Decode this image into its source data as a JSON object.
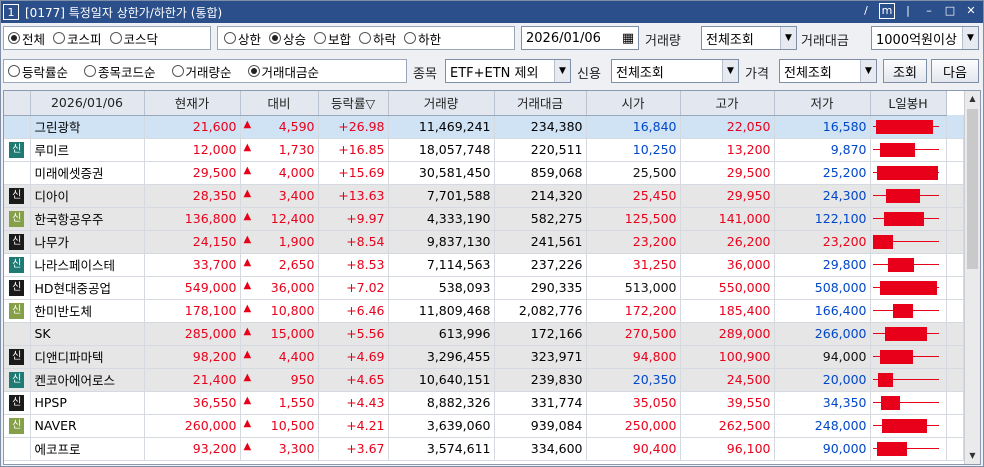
{
  "window": {
    "number": "1",
    "title": "[0177] 특정일자 상한가/하한가 (통합)"
  },
  "title_controls": [
    "/",
    "m",
    "|",
    "–",
    "□",
    "✕"
  ],
  "market": {
    "options": [
      "전체",
      "코스피",
      "코스닥"
    ],
    "selected": 0
  },
  "limit": {
    "options": [
      "상한",
      "상승",
      "보합",
      "하락",
      "하한"
    ],
    "selected": 1
  },
  "date_value": "2026/01/06",
  "volume": {
    "label": "거래량",
    "value": "전체조회"
  },
  "amount": {
    "label": "거래대금",
    "value": "1000억원이상"
  },
  "sort": {
    "options": [
      "등락률순",
      "종목코드순",
      "거래량순",
      "거래대금순"
    ],
    "selected": 3
  },
  "stock_filter": {
    "label": "종목",
    "value": "ETF+ETN 제외"
  },
  "credit": {
    "label": "신용",
    "value": "전체조회"
  },
  "price": {
    "label": "가격",
    "value": "전체조회"
  },
  "buttons": {
    "search": "조회",
    "next": "다음"
  },
  "columns": [
    "2026/01/06",
    "현재가",
    "대비",
    "등락률▽",
    "거래량",
    "거래대금",
    "시가",
    "고가",
    "저가",
    "L일봉H"
  ],
  "rows": [
    {
      "badge": "",
      "name": "그린광학",
      "price": "21,600",
      "diff": "4,590",
      "rate": "+26.98",
      "volume": "11,469,241",
      "amount": "234,380",
      "open": "16,840",
      "high": "22,050",
      "low": "16,580",
      "open_color": "blue",
      "low_color": "blue",
      "bg": "sel",
      "mark": false,
      "candle": {
        "open": 16840,
        "high": 22050,
        "low": 16580,
        "close": 21600
      }
    },
    {
      "badge": "신",
      "name": "루미르",
      "price": "12,000",
      "diff": "1,730",
      "rate": "+16.85",
      "volume": "18,057,748",
      "amount": "220,511",
      "open": "10,250",
      "high": "13,200",
      "low": "9,870",
      "open_color": "blue",
      "low_color": "blue",
      "bg": "",
      "mark": false,
      "candle": {
        "open": 10250,
        "high": 13200,
        "low": 9870,
        "close": 12000
      }
    },
    {
      "badge": "",
      "name": "미래에셋증권",
      "price": "29,500",
      "diff": "4,000",
      "rate": "+15.69",
      "volume": "30,581,450",
      "amount": "859,068",
      "open": "25,500",
      "high": "29,500",
      "low": "25,200",
      "open_color": "blk",
      "low_color": "blue",
      "bg": "",
      "mark": true,
      "candle": {
        "open": 25500,
        "high": 29500,
        "low": 25200,
        "close": 29500
      }
    },
    {
      "badge": "신",
      "name": "디아이",
      "price": "28,350",
      "diff": "3,400",
      "rate": "+13.63",
      "volume": "7,701,588",
      "amount": "214,320",
      "open": "25,450",
      "high": "29,950",
      "low": "24,300",
      "open_color": "red",
      "low_color": "blue",
      "bg": "gray",
      "mark": false,
      "candle": {
        "open": 25450,
        "high": 29950,
        "low": 24300,
        "close": 28350
      }
    },
    {
      "badge": "신",
      "name": "한국항공우주",
      "price": "136,800",
      "diff": "12,400",
      "rate": "+9.97",
      "volume": "4,333,190",
      "amount": "582,275",
      "open": "125,500",
      "high": "141,000",
      "low": "122,100",
      "open_color": "red",
      "low_color": "blue",
      "bg": "gray",
      "mark": true,
      "candle": {
        "open": 125500,
        "high": 141000,
        "low": 122100,
        "close": 136800
      }
    },
    {
      "badge": "신",
      "name": "나무가",
      "price": "24,150",
      "diff": "1,900",
      "rate": "+8.54",
      "volume": "9,837,130",
      "amount": "241,561",
      "open": "23,200",
      "high": "26,200",
      "low": "23,200",
      "open_color": "red",
      "low_color": "red",
      "bg": "gray",
      "mark": false,
      "candle": {
        "open": 23200,
        "high": 26200,
        "low": 23200,
        "close": 24150
      }
    },
    {
      "badge": "신",
      "name": "나라스페이스테",
      "price": "33,700",
      "diff": "2,650",
      "rate": "+8.53",
      "volume": "7,114,563",
      "amount": "237,226",
      "open": "31,250",
      "high": "36,000",
      "low": "29,800",
      "open_color": "red",
      "low_color": "blue",
      "bg": "",
      "mark": false,
      "candle": {
        "open": 31250,
        "high": 36000,
        "low": 29800,
        "close": 33700
      }
    },
    {
      "badge": "신",
      "name": "HD현대중공업",
      "price": "549,000",
      "diff": "36,000",
      "rate": "+7.02",
      "volume": "538,093",
      "amount": "290,335",
      "open": "513,000",
      "high": "550,000",
      "low": "508,000",
      "open_color": "blk",
      "low_color": "blue",
      "bg": "",
      "mark": true,
      "candle": {
        "open": 513000,
        "high": 550000,
        "low": 508000,
        "close": 549000
      }
    },
    {
      "badge": "신",
      "name": "한미반도체",
      "price": "178,100",
      "diff": "10,800",
      "rate": "+6.46",
      "volume": "11,809,468",
      "amount": "2,082,776",
      "open": "172,200",
      "high": "185,400",
      "low": "166,400",
      "open_color": "red",
      "low_color": "blue",
      "bg": "",
      "mark": false,
      "candle": {
        "open": 172200,
        "high": 185400,
        "low": 166400,
        "close": 178100
      }
    },
    {
      "badge": "",
      "name": "SK",
      "price": "285,000",
      "diff": "15,000",
      "rate": "+5.56",
      "volume": "613,996",
      "amount": "172,166",
      "open": "270,500",
      "high": "289,000",
      "low": "266,000",
      "open_color": "red",
      "low_color": "blue",
      "bg": "gray",
      "mark": false,
      "candle": {
        "open": 270500,
        "high": 289000,
        "low": 266000,
        "close": 285000
      }
    },
    {
      "badge": "신",
      "name": "디앤디파마텍",
      "price": "98,200",
      "diff": "4,400",
      "rate": "+4.69",
      "volume": "3,296,455",
      "amount": "323,971",
      "open": "94,800",
      "high": "100,900",
      "low": "94,000",
      "open_color": "red",
      "low_color": "blk",
      "bg": "gray",
      "mark": false,
      "candle": {
        "open": 94800,
        "high": 100900,
        "low": 94000,
        "close": 98200
      }
    },
    {
      "badge": "신",
      "name": "켄코아에어로스",
      "price": "21,400",
      "diff": "950",
      "rate": "+4.65",
      "volume": "10,640,151",
      "amount": "239,830",
      "open": "20,350",
      "high": "24,500",
      "low": "20,000",
      "open_color": "blue",
      "low_color": "blue",
      "bg": "gray",
      "mark": false,
      "candle": {
        "open": 20350,
        "high": 24500,
        "low": 20000,
        "close": 21400
      }
    },
    {
      "badge": "신",
      "name": "HPSP",
      "price": "36,550",
      "diff": "1,550",
      "rate": "+4.43",
      "volume": "8,882,326",
      "amount": "331,774",
      "open": "35,050",
      "high": "39,550",
      "low": "34,350",
      "open_color": "red",
      "low_color": "blue",
      "bg": "",
      "mark": false,
      "candle": {
        "open": 35050,
        "high": 39550,
        "low": 34350,
        "close": 36550
      }
    },
    {
      "badge": "신",
      "name": "NAVER",
      "price": "260,000",
      "diff": "10,500",
      "rate": "+4.21",
      "volume": "3,639,060",
      "amount": "939,084",
      "open": "250,000",
      "high": "262,500",
      "low": "248,000",
      "open_color": "red",
      "low_color": "blue",
      "bg": "",
      "mark": true,
      "candle": {
        "open": 250000,
        "high": 262500,
        "low": 248000,
        "close": 260000
      }
    },
    {
      "badge": "",
      "name": "에코프로",
      "price": "93,200",
      "diff": "3,300",
      "rate": "+3.67",
      "volume": "3,574,611",
      "amount": "334,600",
      "open": "90,400",
      "high": "96,100",
      "low": "90,000",
      "open_color": "red",
      "low_color": "blue",
      "bg": "",
      "mark": false,
      "candle": {
        "open": 90400,
        "high": 96100,
        "low": 90000,
        "close": 93200
      }
    }
  ],
  "badge_styles": [
    "teal",
    "teal",
    "",
    "dark",
    "olive",
    "dark",
    "teal",
    "dark",
    "olive",
    "",
    "dark",
    "teal",
    "dark",
    "olive",
    ""
  ],
  "colors": {
    "up": "#e8001a",
    "down": "#0046c8",
    "title_bar": "#2b4f8a",
    "selected_row": "#cfe3f5"
  }
}
